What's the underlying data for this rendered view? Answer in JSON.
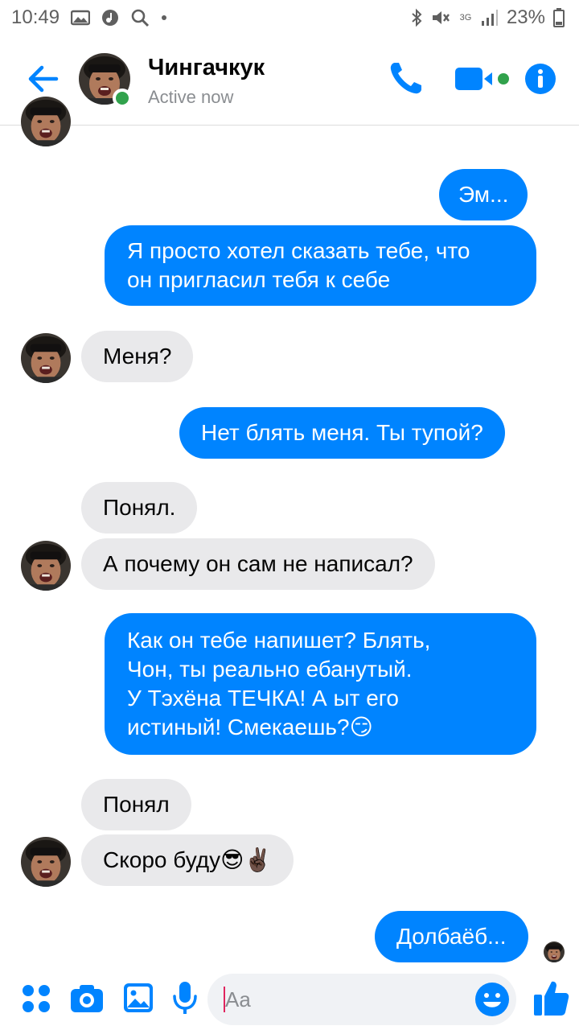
{
  "status_bar": {
    "time": "10:49",
    "network": "3G",
    "battery": "23%",
    "icons": [
      "gallery-icon",
      "music-icon",
      "search-icon",
      "bluetooth-icon",
      "mute-icon",
      "signal-icon",
      "battery-icon"
    ]
  },
  "header": {
    "contact_name": "Чингачкук",
    "status": "Active now",
    "icons": [
      "back-arrow-icon",
      "phone-icon",
      "video-icon",
      "info-icon"
    ],
    "accent_color": "#0084ff",
    "online_color": "#31a24c"
  },
  "messages": [
    {
      "side": "in",
      "text": "Эм..."
    },
    {
      "side": "out",
      "text": "Эм..."
    },
    {
      "side": "out",
      "lines": [
        "Я просто хотел сказать тебе, что",
        "он пригласил тебя к себе"
      ]
    },
    {
      "side": "in",
      "text": "Меня?"
    },
    {
      "side": "out",
      "text": "Нет блять меня. Ты тупой?"
    },
    {
      "side": "in",
      "text": "Понял."
    },
    {
      "side": "in",
      "text": "А почему он сам не написал?"
    },
    {
      "side": "out",
      "lines": [
        "Как он тебе напишет? Блять,",
        "Чон, ты реально ебанутый.",
        "У Тэхёна ТЕЧКА! А ыт его",
        "истиный! Смекаешь?😏"
      ]
    },
    {
      "side": "in",
      "text": "Понял"
    },
    {
      "side": "in",
      "text": "Скоро буду😎✌🏿"
    },
    {
      "side": "out",
      "text": "Долбаёб..."
    }
  ],
  "composer": {
    "placeholder": "Aa",
    "icons": [
      "apps-icon",
      "camera-icon",
      "image-icon",
      "microphone-icon",
      "emoji-icon",
      "thumbs-up-icon"
    ]
  }
}
